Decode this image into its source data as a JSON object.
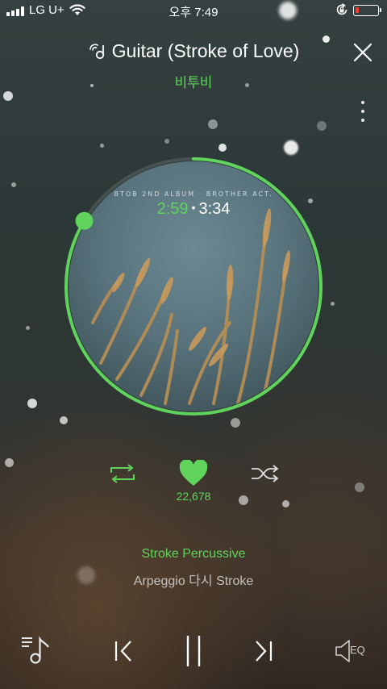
{
  "status_bar": {
    "carrier": "LG U+",
    "time": "오후 7:49",
    "battery_level": 0.15
  },
  "header": {
    "title": "Guitar (Stroke of Love)",
    "artist": "비투비"
  },
  "album": {
    "caption": "BTOB 2ND ALBUM · BROTHER ACT.",
    "elapsed": "2:59",
    "separator": "•",
    "total": "3:34",
    "progress": 0.836
  },
  "actions": {
    "likes": "22,678"
  },
  "lyrics": {
    "current": "Stroke Percussive",
    "next": "Arpeggio 다시 Stroke"
  },
  "player": {
    "eq_label": "EQ"
  },
  "colors": {
    "accent": "#5fd35b",
    "battery_low": "#ff3b30"
  },
  "icons": [
    "guitar-icon",
    "close-icon",
    "more-icon",
    "repeat-icon",
    "heart-icon",
    "shuffle-icon",
    "playlist-icon",
    "previous-icon",
    "pause-icon",
    "next-icon",
    "speaker-icon"
  ]
}
